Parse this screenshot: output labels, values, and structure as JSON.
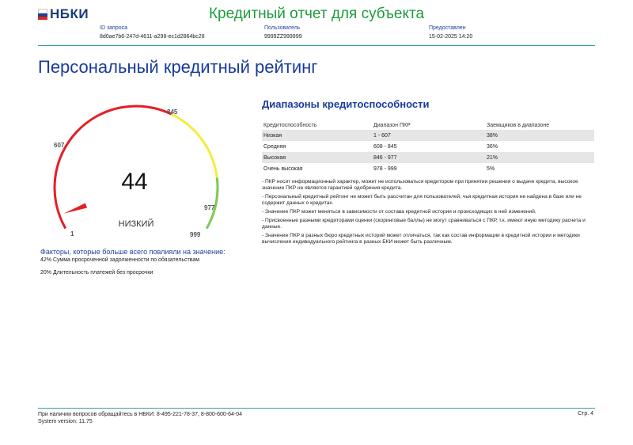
{
  "header": {
    "logo": "НБКИ",
    "title": "Кредитный отчет для субъекта",
    "fields": [
      {
        "label": "ID запроса",
        "value": "8d0ae7b6-247d-4611-a298-ec1d2864bc28"
      },
      {
        "label": "Пользователь",
        "value": "9999ZZ999999"
      },
      {
        "label": "Предоставлен",
        "value": "15-02-2025 14:20"
      }
    ]
  },
  "page_title": "Персональный кредитный рейтинг",
  "gauge": {
    "score": "44",
    "category": "НИЗКИЙ",
    "ticks": [
      "1",
      "607",
      "845",
      "977",
      "999"
    ],
    "colors": {
      "low": "#e41e26",
      "medium": "#f5ec3a",
      "high": "#7ec850",
      "needle": "#e41e26"
    }
  },
  "factors": {
    "title": "Факторы, которые больше всего повлияли на значение:",
    "items": [
      "42% Сумма просроченной задолженности по обязательствам",
      "20% Длительность платежей без просрочки"
    ]
  },
  "ranges": {
    "title": "Диапазоны кредитоспособности",
    "headers": [
      "Кредитоспособность",
      "Диапазон ПКР",
      "Заемщиков в диапазоне"
    ],
    "rows": [
      [
        "Низкая",
        "1 - 607",
        "38%"
      ],
      [
        "Средняя",
        "608 - 845",
        "36%"
      ],
      [
        "Высокая",
        "846 - 977",
        "21%"
      ],
      [
        "Очень высокая",
        "978 - 999",
        "5%"
      ]
    ]
  },
  "notes": [
    "- ПКР носит информационный характер, может не использоваться кредитором при принятии решения о выдаче кредита, высокое значение ПКР не является гарантией одобрения кредита.",
    "- Персональный кредитный рейтинг не может быть рассчитан для пользователей, чья кредитная история не найдена в базе или не содержит данных о кредитах.",
    "- Значение ПКР может меняться в зависимости от состава кредитной истории и происходящих в ней изменений.",
    "- Присвоенные разными кредиторами оценки (скоринговые баллы) не могут сравниваться с ПКР, т.к. имеют иную методику расчета и данные.",
    "- Значение ПКР в разных бюро кредитных историй может отличаться, так как состав информации в кредитной истории и методики вычисления индивидуального рейтинга в разных БКИ может быть различным."
  ],
  "footer": {
    "contacts": "При наличии вопросов обращайтесь в НБКИ: 8-495-221-78-37, 8-800-600-64-04",
    "version": "System version: 11.75",
    "page": "Стр. 4"
  }
}
